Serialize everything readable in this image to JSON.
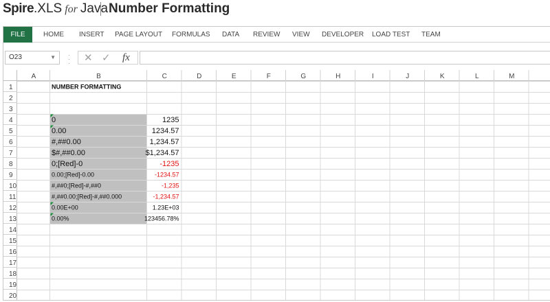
{
  "header": {
    "brand_spire": "Spire",
    "brand_xls": ".XLS",
    "brand_for": "for",
    "brand_java": "Java",
    "title": "Number Formatting"
  },
  "ribbon": {
    "tabs": [
      "FILE",
      "HOME",
      "INSERT",
      "PAGE LAYOUT",
      "FORMULAS",
      "DATA",
      "REVIEW",
      "VIEW",
      "DEVELOPER",
      "LOAD TEST",
      "TEAM"
    ],
    "active_color": "#217346"
  },
  "formula_bar": {
    "name_box": "O23",
    "cancel_icon": "close-icon",
    "enter_icon": "check-icon",
    "function_icon": "fx-icon",
    "formula": ""
  },
  "sheet": {
    "columns": [
      "A",
      "B",
      "C",
      "D",
      "E",
      "F",
      "G",
      "H",
      "I",
      "J",
      "K",
      "L",
      "M"
    ],
    "rows": [
      "1",
      "2",
      "3",
      "4",
      "5",
      "6",
      "7",
      "8",
      "9",
      "10",
      "11",
      "12",
      "13",
      "14",
      "15",
      "16",
      "17",
      "18",
      "19",
      "20"
    ],
    "shaded_fill": "#c0c0c0",
    "red": "#e01010",
    "cells": [
      {
        "ref": "B1",
        "row": 1,
        "col": "B",
        "text": "NUMBER FORMATTING",
        "bold": true
      },
      {
        "ref": "B4",
        "row": 4,
        "col": "B",
        "text": "0",
        "shaded": true,
        "marker": true,
        "size": "large"
      },
      {
        "ref": "C4",
        "row": 4,
        "col": "C",
        "text": "1235",
        "align": "right",
        "size": "large"
      },
      {
        "ref": "B5",
        "row": 5,
        "col": "B",
        "text": "0.00",
        "shaded": true,
        "marker": true,
        "size": "large"
      },
      {
        "ref": "C5",
        "row": 5,
        "col": "C",
        "text": "1234.57",
        "align": "right",
        "size": "large"
      },
      {
        "ref": "B6",
        "row": 6,
        "col": "B",
        "text": "#,##0.00",
        "shaded": true,
        "size": "large"
      },
      {
        "ref": "C6",
        "row": 6,
        "col": "C",
        "text": "1,234.57",
        "align": "right",
        "size": "large"
      },
      {
        "ref": "B7",
        "row": 7,
        "col": "B",
        "text": "$#,##0.00",
        "shaded": true,
        "size": "large"
      },
      {
        "ref": "C7",
        "row": 7,
        "col": "C",
        "text": "$1,234.57",
        "align": "right",
        "size": "large"
      },
      {
        "ref": "B8",
        "row": 8,
        "col": "B",
        "text": "0;[Red]-0",
        "shaded": true,
        "size": "large"
      },
      {
        "ref": "C8",
        "row": 8,
        "col": "C",
        "text": "-1235",
        "align": "right",
        "red": true,
        "size": "large"
      },
      {
        "ref": "B9",
        "row": 9,
        "col": "B",
        "text": "0.00;[Red]-0.00",
        "shaded": true
      },
      {
        "ref": "C9",
        "row": 9,
        "col": "C",
        "text": "-1234.57",
        "align": "right",
        "red": true
      },
      {
        "ref": "B10",
        "row": 10,
        "col": "B",
        "text": "#,##0;[Red]-#,##0",
        "shaded": true
      },
      {
        "ref": "C10",
        "row": 10,
        "col": "C",
        "text": "-1,235",
        "align": "right",
        "red": true
      },
      {
        "ref": "B11",
        "row": 11,
        "col": "B",
        "text": "#,##0.00;[Red]-#,##0.000",
        "shaded": true
      },
      {
        "ref": "C11",
        "row": 11,
        "col": "C",
        "text": "-1,234.57",
        "align": "right",
        "red": true
      },
      {
        "ref": "B12",
        "row": 12,
        "col": "B",
        "text": "0.00E+00",
        "shaded": true,
        "marker": true
      },
      {
        "ref": "C12",
        "row": 12,
        "col": "C",
        "text": "1.23E+03",
        "align": "right"
      },
      {
        "ref": "B13",
        "row": 13,
        "col": "B",
        "text": "0.00%",
        "shaded": true,
        "marker": true
      },
      {
        "ref": "C13",
        "row": 13,
        "col": "C",
        "text": "123456.78%",
        "align": "right"
      }
    ]
  }
}
